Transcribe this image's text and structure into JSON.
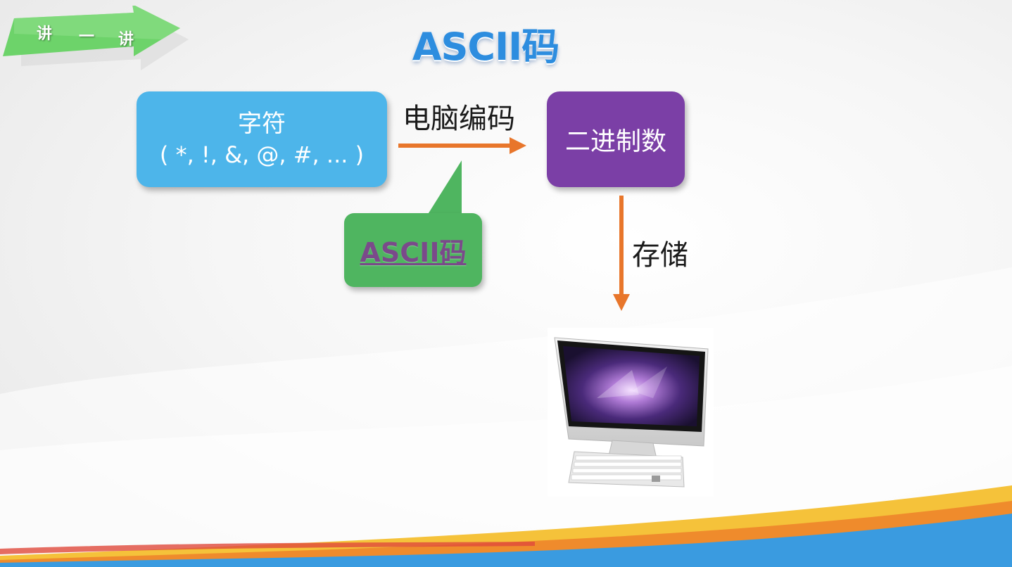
{
  "banner": {
    "chars": [
      "讲",
      "一",
      "讲"
    ]
  },
  "title": "ASCII码",
  "diagram": {
    "source_box": {
      "line1": "字符",
      "line2": "( *, !, &, @, #, ... )"
    },
    "encode_label": "电脑编码",
    "target_box": "二进制数",
    "callout": "ASCII码",
    "store_label": "存储",
    "computer": "computer-icon"
  },
  "colors": {
    "title": "#2d8ddf",
    "source_box": "#4db5ea",
    "target_box": "#7b3fa6",
    "callout": "#4fb560",
    "arrow": "#e8762b",
    "banner": "#6dd36a"
  }
}
